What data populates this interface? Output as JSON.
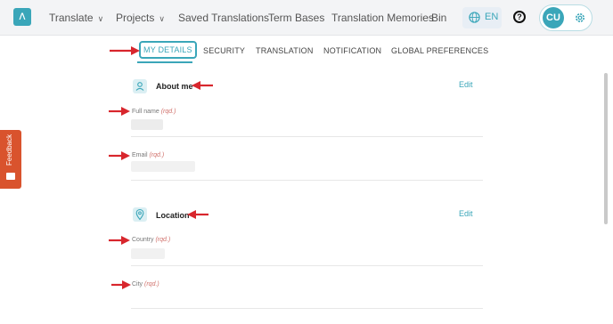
{
  "nav": {
    "logo": "ʌ",
    "items": [
      {
        "label": "Translate",
        "has_dropdown": true
      },
      {
        "label": "Projects",
        "has_dropdown": true
      },
      {
        "label": "Saved Translations",
        "has_dropdown": false
      },
      {
        "label": "Term Bases",
        "has_dropdown": false
      },
      {
        "label": "Translation Memories",
        "has_dropdown": false
      },
      {
        "label": "Bin",
        "has_dropdown": false
      }
    ],
    "chevron": "∨",
    "language": "EN",
    "help": "?",
    "user_initials": "CU"
  },
  "tabs": [
    {
      "label": "MY DETAILS",
      "active": true
    },
    {
      "label": "SECURITY",
      "active": false
    },
    {
      "label": "TRANSLATION",
      "active": false
    },
    {
      "label": "NOTIFICATION",
      "active": false
    },
    {
      "label": "GLOBAL PREFERENCES",
      "active": false
    }
  ],
  "about": {
    "title": "About me",
    "edit": "Edit",
    "fields": [
      {
        "label": "Full name",
        "required": "(rqd.)"
      },
      {
        "label": "Email",
        "required": "(rqd.)"
      }
    ]
  },
  "location": {
    "title": "Location",
    "edit": "Edit",
    "fields": [
      {
        "label": "Country",
        "required": "(rqd.)"
      },
      {
        "label": "City",
        "required": "(rqd.)"
      }
    ]
  },
  "feedback": {
    "label": "Feedback"
  },
  "colors": {
    "accent": "#3aa6b9",
    "annotation_arrow": "#d8262d",
    "feedback": "#d9532d"
  }
}
